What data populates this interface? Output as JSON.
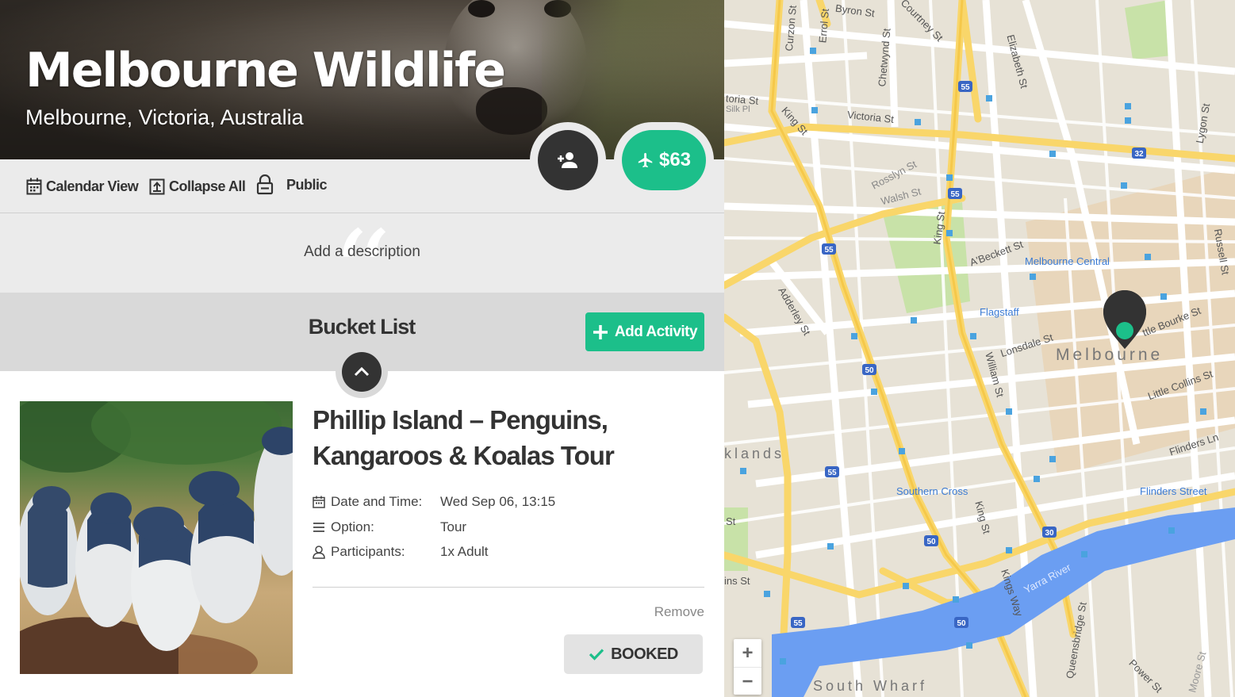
{
  "trip": {
    "title": "Melbourne Wildlife",
    "location": "Melbourne, Victoria, Australia",
    "price": "$63"
  },
  "toolbar": {
    "calendar_view": "Calendar View",
    "collapse_all": "Collapse All",
    "visibility": "Public"
  },
  "description": {
    "placeholder": "Add a description"
  },
  "bucket_list": {
    "title": "Bucket List",
    "add_activity": "Add Activity"
  },
  "activity": {
    "title": "Phillip Island – Penguins, Kangaroos & Koalas Tour",
    "details": [
      {
        "icon": "calendar-icon",
        "label": "Date and Time:",
        "value": "Wed Sep 06, 13:15"
      },
      {
        "icon": "list-icon",
        "label": "Option:",
        "value": "Tour"
      },
      {
        "icon": "user-icon",
        "label": "Participants:",
        "value": "1x Adult"
      }
    ],
    "remove": "Remove",
    "status": "BOOKED"
  },
  "map": {
    "zoom_in": "+",
    "zoom_out": "−",
    "areas": [
      "Melbourne",
      "South Wharf",
      "klands"
    ],
    "stations": [
      "Melbourne Central",
      "Flagstaff",
      "Southern Cross",
      "Flinders Street"
    ],
    "streets": [
      "Byron St",
      "Courtney St",
      "Chetwynd St",
      "Errol St",
      "Curzon St",
      "toria St",
      "Silk Pl",
      "King St",
      "Victoria St",
      "Rosslyn St",
      "Walsh St",
      "Elizabeth St",
      "A'Beckett St",
      "Adderley St",
      "William St",
      "Lonsdale St",
      "ttle Bourke St",
      "Little Collins St",
      "Flinders Ln",
      "Russell St",
      "Lygon St",
      "Yarra River",
      "Kings Way",
      "Queensbridge St",
      "Power St",
      "Moore St",
      "St",
      "ins St"
    ],
    "route_shields": [
      "55",
      "55",
      "55",
      "55",
      "32",
      "50",
      "50",
      "30",
      "50",
      "50",
      "55",
      "55"
    ],
    "colors": {
      "accent": "#1cbf8a",
      "road": "#f9d66a",
      "water": "#6b9ef2",
      "land": "#e7e2d6",
      "park": "#c8e2a8",
      "pin": "#333333"
    }
  }
}
